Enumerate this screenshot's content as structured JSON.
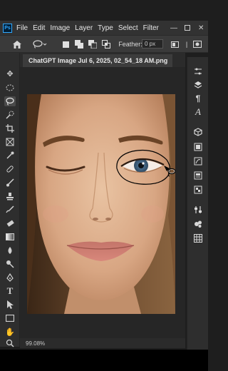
{
  "menubar": {
    "logo_text": "Ps",
    "items": [
      "File",
      "Edit",
      "Image",
      "Layer",
      "Type",
      "Select",
      "Filter"
    ],
    "window_controls": [
      "minimize-icon",
      "restore-icon",
      "close-icon"
    ]
  },
  "options": {
    "home_icon": "home-icon",
    "tool_preset_icon": "lasso-icon",
    "selection_modes": [
      "new-selection",
      "add-to-selection",
      "subtract-from-selection",
      "intersect-selection"
    ],
    "feather_label": "Feather:",
    "feather_value": "0 px"
  },
  "document": {
    "tab_title": "ChatGPT Image Jul 6, 2025, 02_54_18 AM.png",
    "zoom": "99.08%"
  },
  "tools": [
    "move-tool",
    "marquee-tool",
    "lasso-tool",
    "quick-selection-tool",
    "crop-tool",
    "frame-tool",
    "eyedropper-tool",
    "spot-healing-tool",
    "brush-tool",
    "clone-stamp-tool",
    "history-brush-tool",
    "eraser-tool",
    "gradient-tool",
    "blur-tool",
    "dodge-tool",
    "pen-tool",
    "type-tool",
    "path-selection-tool",
    "rectangle-tool",
    "hand-tool",
    "zoom-tool"
  ],
  "panels": [
    "properties-icon",
    "layers-icon",
    "paragraph-icon",
    "character-icon",
    "3d-icon",
    "channels-icon",
    "paths-icon",
    "libraries-icon",
    "swatches-icon",
    "adjustments-icon",
    "brushes-icon",
    "styles-icon"
  ],
  "colors": {
    "accent": "#31a8ff",
    "panel": "#2e2e2e",
    "menubar": "#323232"
  }
}
